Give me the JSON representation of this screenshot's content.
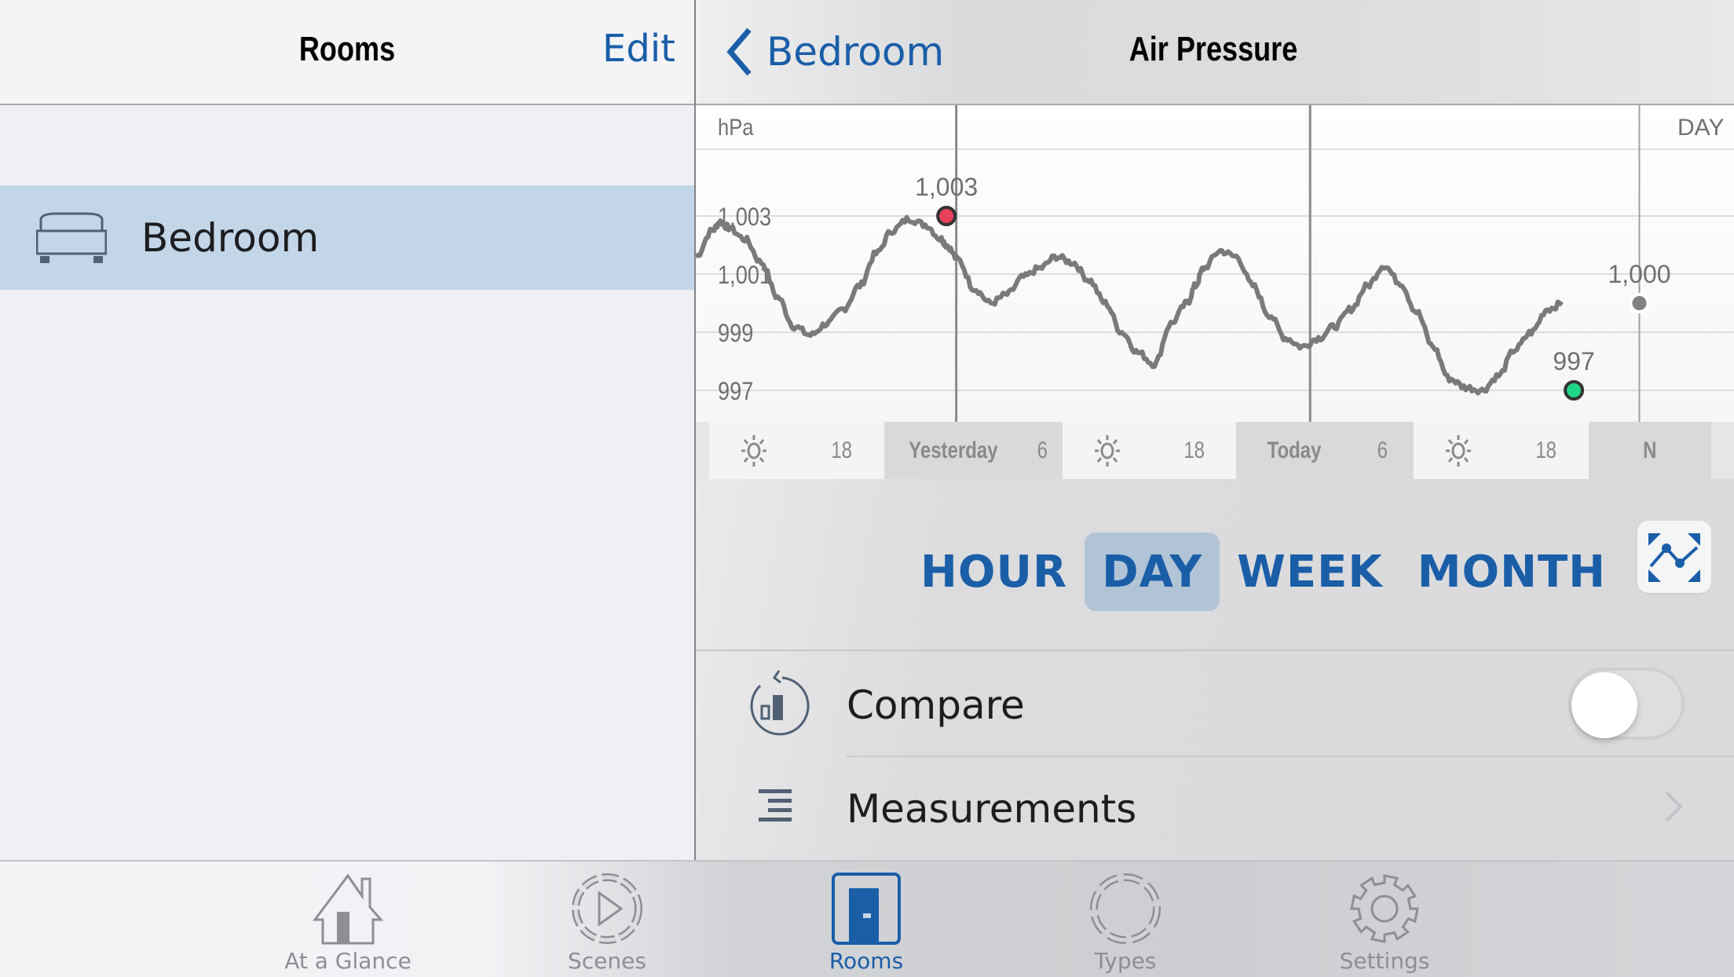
{
  "left_panel": {
    "title": "Rooms",
    "edit_label": "Edit",
    "rooms": [
      {
        "label": "Bedroom",
        "icon": "bed-icon",
        "selected": true
      }
    ]
  },
  "right_panel": {
    "back_label": "Bedroom",
    "title": "Air Pressure",
    "ranges": [
      {
        "label": "HOUR",
        "active": false
      },
      {
        "label": "DAY",
        "active": true
      },
      {
        "label": "WEEK",
        "active": false
      },
      {
        "label": "MONTH",
        "active": false
      }
    ],
    "chart_mode_icon": "line-chart-expand-icon",
    "options": [
      {
        "label": "Compare",
        "icon": "compare-icon",
        "control": "toggle",
        "value": false
      },
      {
        "label": "Measurements",
        "icon": "list-icon",
        "control": "chevron"
      }
    ]
  },
  "tabbar": {
    "items": [
      {
        "label": "At a Glance",
        "icon": "home-icon",
        "active": false
      },
      {
        "label": "Scenes",
        "icon": "scenes-play-icon",
        "active": false
      },
      {
        "label": "Rooms",
        "icon": "door-icon",
        "active": true
      },
      {
        "label": "Types",
        "icon": "types-ring-icon",
        "active": false
      },
      {
        "label": "Settings",
        "icon": "gear-icon",
        "active": false
      }
    ]
  },
  "colors": {
    "accent": "#1a5ea8",
    "selected_row": "#c2d6e8",
    "max_marker": "#e8405a",
    "min_marker": "#1ed687",
    "current_marker": "#808080",
    "line": "#7a7a7a"
  },
  "chart_data": {
    "type": "line",
    "title": "Air Pressure",
    "unit_label": "hPa",
    "range_label": "DAY",
    "ylabel": "hPa",
    "ylim": [
      995.8,
      1005.2
    ],
    "y_ticks": [
      997,
      999,
      1001,
      1003
    ],
    "y_tick_labels": [
      "997",
      "999",
      "1,001",
      "1,003"
    ],
    "grid": true,
    "x_hours_start": 0,
    "x_hours_end": 60.5,
    "x_band": [
      {
        "label": "",
        "kind": "edge",
        "from": -1,
        "to": 0.8
      },
      {
        "label": "",
        "kind": "sun",
        "from": 0.8,
        "to": 11.5
      },
      {
        "label": "18",
        "kind": "hour",
        "from": 0.8,
        "to": 11.5
      },
      {
        "label": "Yesterday",
        "kind": "named",
        "from": 11.5,
        "to": 22.4
      },
      {
        "label": "6",
        "kind": "hour",
        "from": 11.5,
        "to": 22.4
      },
      {
        "label": "",
        "kind": "sun",
        "from": 22.4,
        "to": 33
      },
      {
        "label": "18",
        "kind": "hour",
        "from": 22.4,
        "to": 33
      },
      {
        "label": "Today",
        "kind": "named",
        "from": 33,
        "to": 43.8
      },
      {
        "label": "6",
        "kind": "hour",
        "from": 33,
        "to": 43.8
      },
      {
        "label": "",
        "kind": "sun",
        "from": 43.8,
        "to": 54.5
      },
      {
        "label": "18",
        "kind": "hour",
        "from": 43.8,
        "to": 54.5
      },
      {
        "label": "N",
        "kind": "named",
        "from": 54.5,
        "to": 62
      }
    ],
    "vlines": [
      15.9,
      37.5,
      57.6
    ],
    "x": [
      0,
      1,
      1.5,
      2,
      3,
      4,
      5,
      6,
      7,
      8,
      9,
      10,
      11,
      12,
      13,
      14,
      15,
      15.3,
      16,
      17,
      18,
      19,
      20,
      21,
      22,
      23,
      24,
      25,
      26,
      27,
      28,
      29,
      30,
      30.5,
      31,
      32,
      33,
      34,
      35,
      36,
      37,
      38,
      39,
      40,
      41,
      42,
      43,
      44,
      45,
      46,
      47,
      48,
      49,
      50,
      51,
      52,
      53,
      54,
      55,
      56,
      57,
      57.6
    ],
    "values": [
      1001.6,
      1002.5,
      1002.8,
      1002.6,
      1002.2,
      1001.4,
      1000.2,
      999.2,
      998.9,
      999.3,
      999.8,
      1000.6,
      1001.7,
      1002.5,
      1002.9,
      1002.7,
      1002.2,
      1002.0,
      1001.5,
      1000.5,
      1000.0,
      1000.3,
      1000.9,
      1001.2,
      1001.6,
      1001.4,
      1000.8,
      1000.0,
      999.0,
      998.3,
      997.9,
      999.3,
      1000.0,
      1000.6,
      1001.2,
      1001.8,
      1001.6,
      1000.6,
      999.6,
      998.8,
      998.5,
      998.8,
      999.2,
      999.8,
      1000.6,
      1001.3,
      1000.7,
      999.7,
      998.5,
      997.4,
      997.1,
      997.0,
      997.5,
      998.4,
      999.0,
      999.8,
      1000.0
    ],
    "annotations": [
      {
        "label": "1,003",
        "value": 1003,
        "x": 15.3,
        "kind": "max"
      },
      {
        "label": "997",
        "value": 997,
        "x": 53.6,
        "kind": "min"
      },
      {
        "label": "1,000",
        "value": 1000,
        "x": 57.6,
        "kind": "current"
      }
    ]
  }
}
